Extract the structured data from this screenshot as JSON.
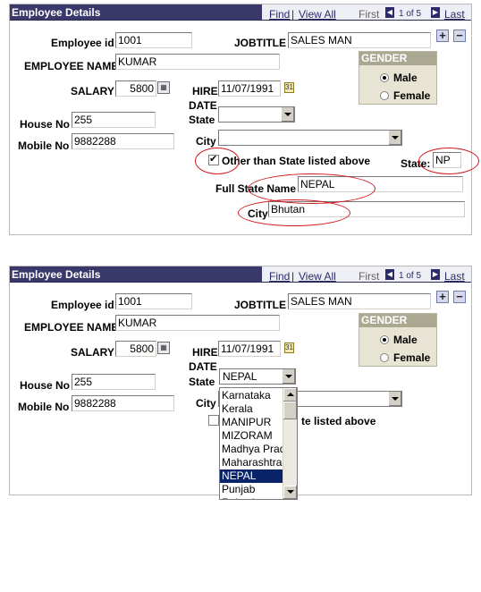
{
  "panel_top": {
    "title": "Employee Details",
    "nav": {
      "find": "Find",
      "sep": "|",
      "view_all": "View All",
      "first": "First",
      "count": "1 of 5",
      "last": "Last"
    },
    "labels": {
      "employee_id": "Employee id",
      "jobtitle": "JOBTITLE",
      "employee_name": "EMPLOYEE NAME",
      "salary": "SALARY",
      "hire": "HIRE",
      "date": "DATE",
      "state": "State",
      "house_no": "House No",
      "mobile_no": "Mobile No",
      "city": "City",
      "other_state": "Other than State listed above",
      "state_code": "State:",
      "full_state": "Full State Name",
      "city2": "City"
    },
    "values": {
      "employee_id": "1001",
      "jobtitle": "SALES MAN",
      "employee_name": "KUMAR",
      "salary": "5800",
      "hire_date": "11/07/1991",
      "state": "",
      "house_no": "255",
      "mobile_no": "9882288",
      "city": "",
      "state_code": "NP",
      "full_state": "NEPAL",
      "city2": "Bhutan"
    },
    "gender": {
      "title": "GENDER",
      "male": "Male",
      "female": "Female",
      "selected": "Male"
    },
    "other_state_checked": true
  },
  "panel_bottom": {
    "title": "Employee Details",
    "nav": {
      "find": "Find",
      "sep": "|",
      "view_all": "View All",
      "first": "First",
      "count": "1 of 5",
      "last": "Last"
    },
    "labels": {
      "employee_id": "Employee id",
      "jobtitle": "JOBTITLE",
      "employee_name": "EMPLOYEE NAME",
      "salary": "SALARY",
      "hire": "HIRE",
      "date": "DATE",
      "state": "State",
      "house_no": "House No",
      "mobile_no": "Mobile No",
      "city": "City",
      "other_state_partial": "te listed above"
    },
    "values": {
      "employee_id": "1001",
      "jobtitle": "SALES MAN",
      "employee_name": "KUMAR",
      "salary": "5800",
      "hire_date": "11/07/1991",
      "state": "NEPAL",
      "house_no": "255",
      "mobile_no": "9882288"
    },
    "gender": {
      "title": "GENDER",
      "male": "Male",
      "female": "Female",
      "selected": "Male"
    },
    "state_options": [
      "Karnataka",
      "Kerala",
      "MANIPUR",
      "MIZORAM",
      "Madhya Prad",
      "Maharashtra",
      "NEPAL",
      "Punjab",
      "Rajasthan"
    ],
    "state_selected": "NEPAL"
  },
  "colors": {
    "header_bg": "#39386b",
    "annotation": "#d0181e",
    "gender_bg": "#e8e4d4",
    "selection": "#0a246a"
  },
  "icons": [
    "calendar-icon",
    "plus-icon",
    "minus-icon",
    "nav-prev-icon",
    "nav-next-icon",
    "dropdown-arrow-icon"
  ]
}
